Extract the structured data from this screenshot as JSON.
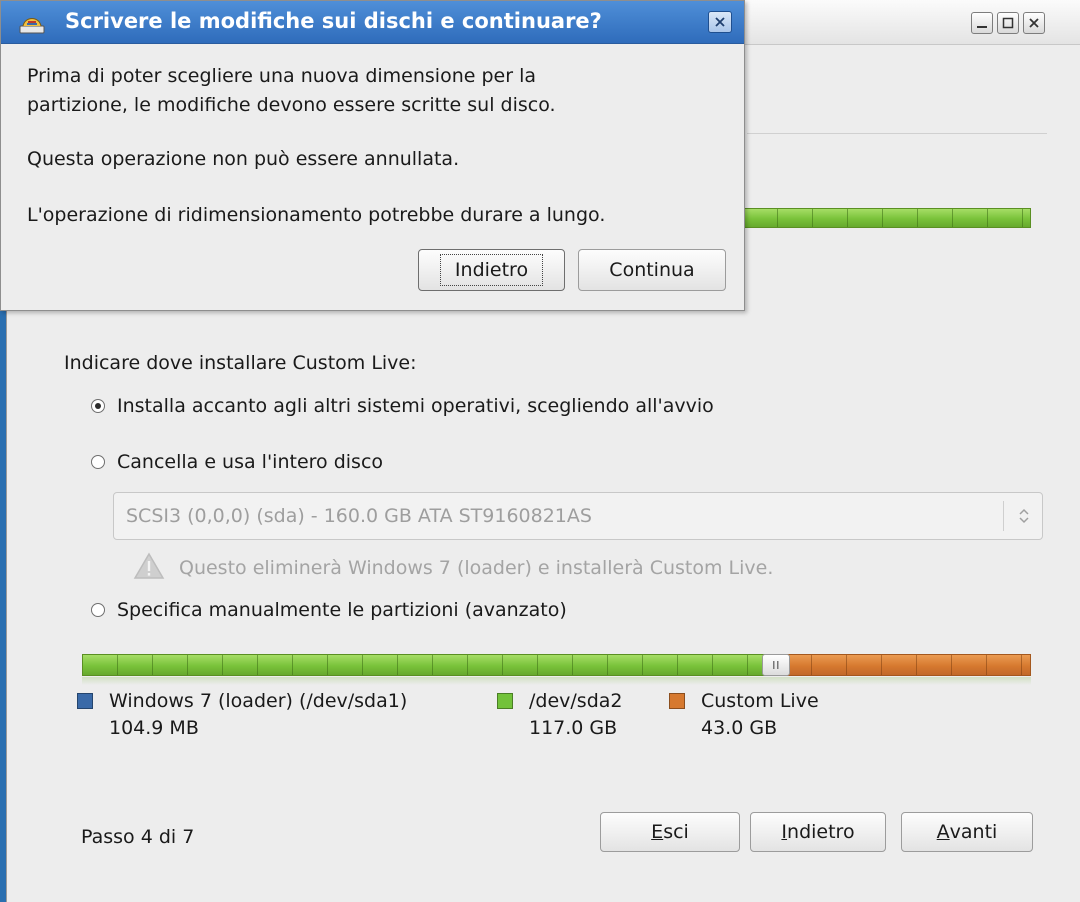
{
  "desktop": {
    "background": "#2a6fb0"
  },
  "main_window": {
    "controls": [
      "minimize-icon",
      "maximize-icon",
      "close-icon"
    ],
    "install_prompt": "Indicare dove installare Custom Live:",
    "options": [
      {
        "label": "Installa accanto agli altri sistemi operativi, scegliendo all'avvio",
        "selected": true
      },
      {
        "label": "Cancella e usa l'intero disco",
        "selected": false
      },
      {
        "label": "Specifica manualmente le partizioni (avanzato)",
        "selected": false
      }
    ],
    "disk_select": {
      "value": "SCSI3 (0,0,0) (sda) - 160.0 GB ATA ST9160821AS",
      "enabled": false
    },
    "warning": {
      "icon": "warning-icon",
      "text": "Questo eliminerà Windows 7 (loader) e installerà Custom Live."
    },
    "partitions": [
      {
        "name": "Windows 7 (loader) (/dev/sda1)",
        "size": "104.9 MB",
        "color": "#3a6aa8"
      },
      {
        "name": "/dev/sda2",
        "size": "117.0 GB",
        "color": "#72c23a"
      },
      {
        "name": "Custom Live",
        "size": "43.0 GB",
        "color": "#d6792f"
      }
    ],
    "partition_bar": {
      "green_fraction": 0.731,
      "orange_fraction": 0.269
    },
    "step": "Passo 4 di 7",
    "buttons": {
      "quit": {
        "pre": "",
        "mnemonic": "E",
        "post": "sci"
      },
      "back": {
        "pre": "",
        "mnemonic": "I",
        "post": "ndietro"
      },
      "next": {
        "pre": "",
        "mnemonic": "A",
        "post": "vanti"
      }
    }
  },
  "dialog": {
    "title": "Scrivere le modifiche sui dischi e continuare?",
    "line1": "Prima di poter scegliere una nuova dimensione per la",
    "line2": "partizione, le modifiche devono essere scritte sul disco.",
    "line3": "Questa operazione non può essere annullata.",
    "line4": "L'operazione di ridimensionamento potrebbe durare a lungo.",
    "back_label": "Indietro",
    "continue_label": "Continua"
  }
}
